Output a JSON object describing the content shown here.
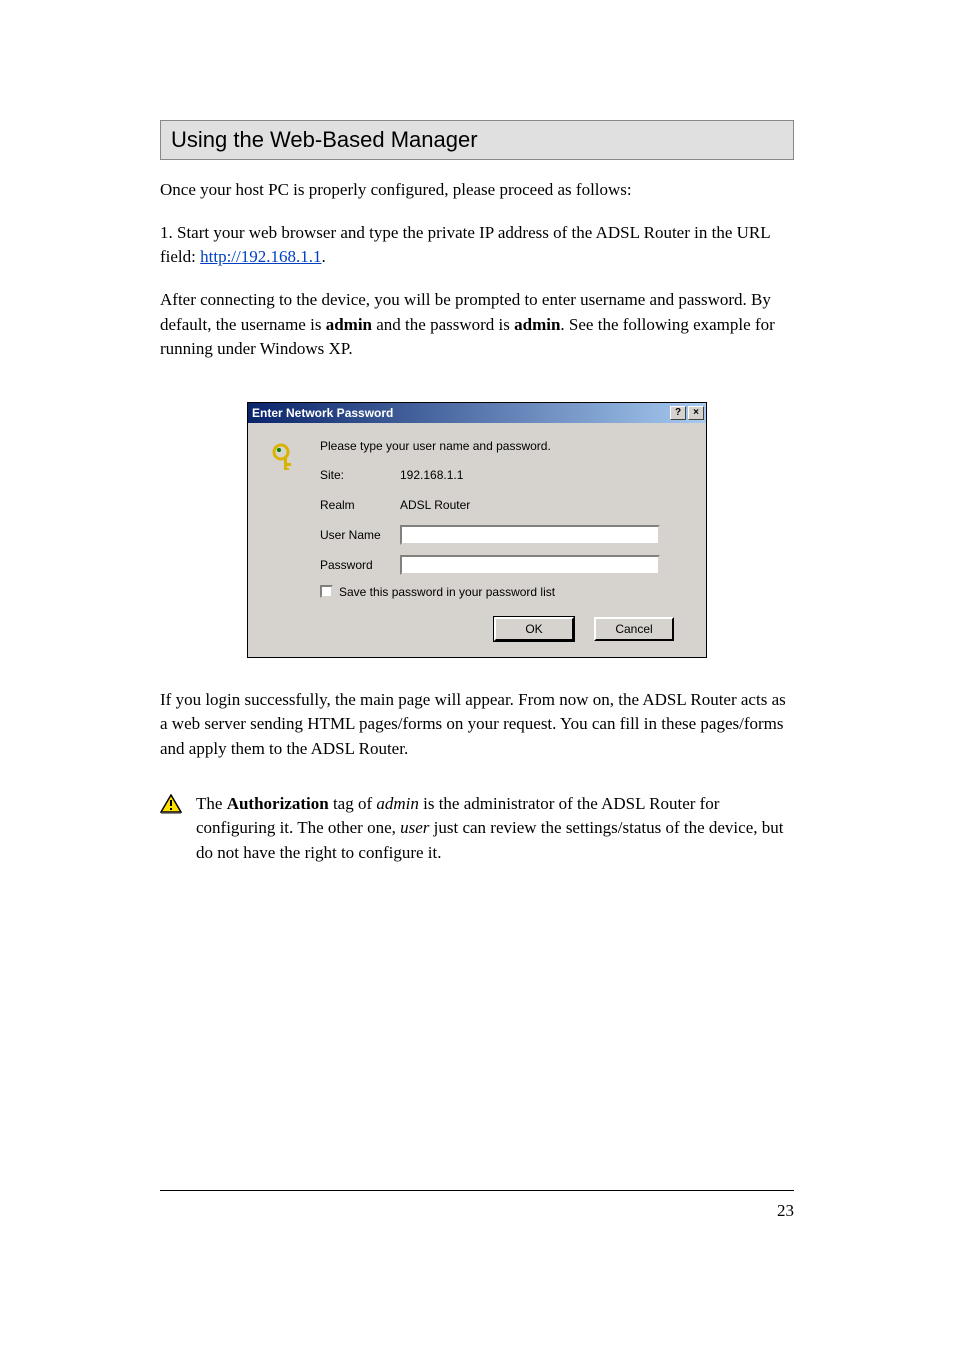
{
  "section_title": "Using the Web-Based Manager",
  "para1_prefix": "Once your host PC is properly configured, please proceed as follows:",
  "step_prefix": "1. Start your web browser and type the private IP address of the ADSL Router in the URL field: ",
  "router_url": "http://192.168.1.1",
  "step_suffix": ".",
  "para2": "After connecting to the device, you will be prompted to enter username and password. By default, the username is ",
  "para2_strong1": "admin",
  "para2_mid": " and the password is ",
  "para2_strong2": "admin",
  "para2_end": ". See the following ",
  "para2_bold_end": "example",
  "para2_note": " for running under Windows XP.",
  "dialog": {
    "title": "Enter Network Password",
    "help_btn": "?",
    "close_btn": "×",
    "prompt": "Please type your user name and password.",
    "site_label": "Site:",
    "site_value": "192.168.1.1",
    "realm_label": "Realm",
    "realm_value": "ADSL Router",
    "user_label": "User Name",
    "pass_label": "Password",
    "save_label": "Save this password in your password list",
    "ok": "OK",
    "cancel": "Cancel"
  },
  "post_dialog": "If you login successfully, the main page will appear. From now on, the ADSL Router acts as a web server sending HTML pages/forms on your request. You can fill in these pages/forms and apply them to the ADSL Router.",
  "warning": {
    "text1": "The ",
    "strong1": "Authorization",
    "text2": " tag of ",
    "em1": "admin",
    "text3": " is the administrator of the ADSL Router for configuring it. The other one, ",
    "em2": "user",
    "text4": " just can review the settings/status of the device, but do not have the right to configure it."
  },
  "page_number": "23"
}
